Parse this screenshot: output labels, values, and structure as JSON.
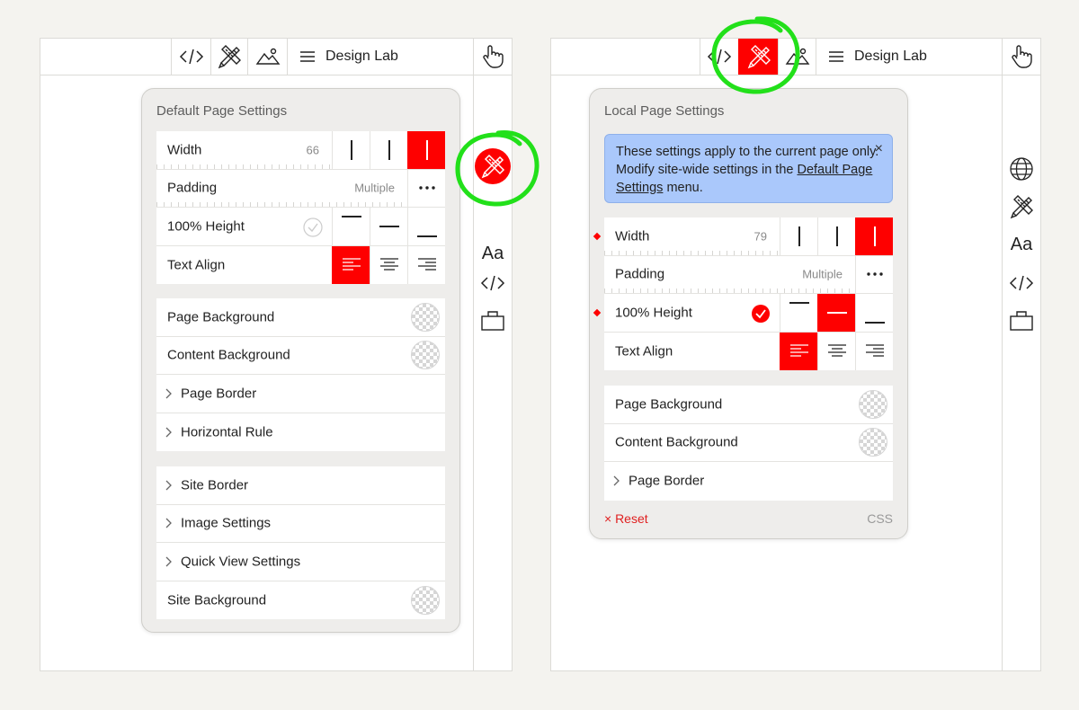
{
  "left": {
    "topbar": {
      "menu_label": "Design Lab"
    },
    "panel": {
      "title": "Default Page Settings",
      "layout_rows": [
        {
          "label": "Width",
          "value": "66"
        },
        {
          "label": "Padding",
          "value": "Multiple"
        },
        {
          "label": "100% Height"
        },
        {
          "label": "Text Align"
        }
      ],
      "bg_rows": [
        {
          "label": "Page Background"
        },
        {
          "label": "Content Background"
        },
        {
          "label": "Page Border"
        },
        {
          "label": "Horizontal Rule"
        }
      ],
      "site_rows": [
        {
          "label": "Site Border"
        },
        {
          "label": "Image Settings"
        },
        {
          "label": "Quick View Settings"
        },
        {
          "label": "Site Background"
        }
      ]
    },
    "rail": {
      "font_label": "Aa"
    }
  },
  "right": {
    "topbar": {
      "menu_label": "Design Lab"
    },
    "panel": {
      "title": "Local Page Settings",
      "info": {
        "text_before": "These settings apply to the current page only. Modify site-wide settings in the",
        "link": "Default Page Settings",
        "text_after": "menu.",
        "close": "×"
      },
      "layout_rows": [
        {
          "label": "Width",
          "value": "79"
        },
        {
          "label": "Padding",
          "value": "Multiple"
        },
        {
          "label": "100% Height"
        },
        {
          "label": "Text Align"
        }
      ],
      "bg_rows": [
        {
          "label": "Page Background"
        },
        {
          "label": "Content Background"
        },
        {
          "label": "Page Border"
        }
      ],
      "reset_label": "× Reset",
      "css_label": "CSS"
    },
    "rail": {
      "font_label": "Aa"
    }
  },
  "colors": {
    "accent": "#fe0000",
    "annotation": "#22e01a",
    "info_bg": "#aac8fb"
  },
  "icons": [
    "code-icon",
    "design-tools-icon",
    "image-icon",
    "hamburger-icon",
    "hand-pointer-icon",
    "globe-icon",
    "bag-icon",
    "chevron-right-icon",
    "checkmark-icon",
    "more-icon"
  ]
}
